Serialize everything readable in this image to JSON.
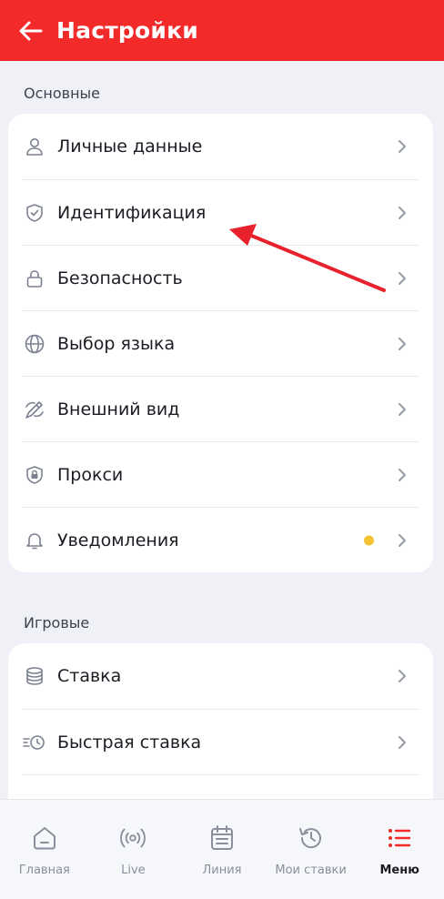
{
  "header": {
    "title": "Настройки",
    "back_icon": "arrow-left-icon",
    "background": "#f32a2a"
  },
  "sections": [
    {
      "label": "Основные",
      "items": [
        {
          "label": "Личные данные",
          "icon": "user-icon"
        },
        {
          "label": "Идентификация",
          "icon": "shield-check-icon"
        },
        {
          "label": "Безопасность",
          "icon": "lock-icon"
        },
        {
          "label": "Выбор языка",
          "icon": "globe-icon"
        },
        {
          "label": "Внешний вид",
          "icon": "brush-icon"
        },
        {
          "label": "Прокси",
          "icon": "shield-lock-icon"
        },
        {
          "label": "Уведомления",
          "icon": "bell-icon",
          "badge_color": "#f5c233"
        }
      ]
    },
    {
      "label": "Игровые",
      "items": [
        {
          "label": "Ставка",
          "icon": "coins-icon"
        },
        {
          "label": "Быстрая ставка",
          "icon": "fast-timer-icon"
        }
      ]
    }
  ],
  "annotation": {
    "color": "#e8222c",
    "points_to": "Идентификация"
  },
  "bottom_nav": {
    "active": "Меню",
    "items": [
      {
        "label": "Главная",
        "icon": "home-icon"
      },
      {
        "label": "Live",
        "icon": "broadcast-icon"
      },
      {
        "label": "Линия",
        "icon": "calendar-icon"
      },
      {
        "label": "Мои ставки",
        "icon": "history-icon"
      },
      {
        "label": "Меню",
        "icon": "menu-list-icon"
      }
    ]
  },
  "colors": {
    "accent": "#f32a2a",
    "chevron": "#9aa0ab",
    "icon": "#7b8190"
  }
}
